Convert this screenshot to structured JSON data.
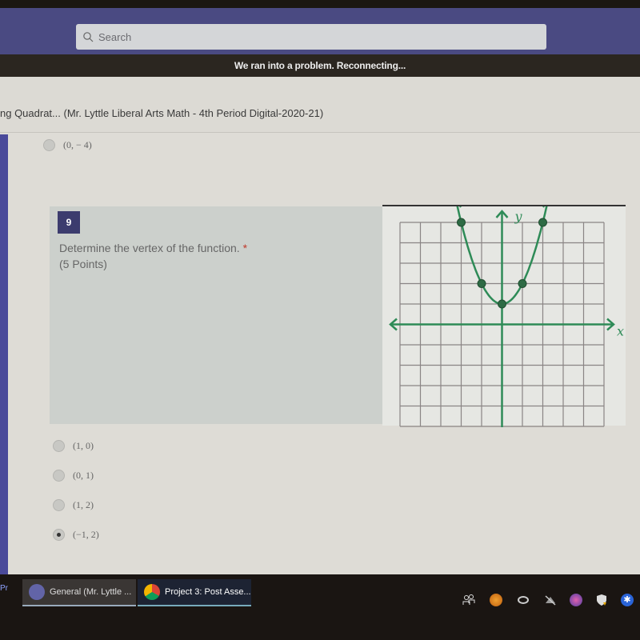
{
  "app": {
    "search_placeholder": "Search",
    "banner": "We ran into a problem. Reconnecting..."
  },
  "form": {
    "title": "ng Quadrat... (Mr. Lyttle Liberal Arts Math - 4th Period Digital-2020-21)",
    "previous_option": {
      "label": "(0,  − 4)",
      "selected": false
    }
  },
  "question": {
    "number": "9",
    "text": "Determine the vertex of the function.",
    "required_mark": "*",
    "points": "(5 Points)",
    "graph": {
      "x_label": "x",
      "y_label": "y",
      "x_range": [
        -5,
        5
      ],
      "y_range": [
        -5,
        5
      ],
      "curve": "parabola",
      "points": [
        [
          -2,
          5
        ],
        [
          -1,
          2
        ],
        [
          0,
          1
        ],
        [
          1,
          2
        ],
        [
          2,
          5
        ]
      ],
      "color": "#2e8b57"
    },
    "options": [
      {
        "label": "(1, 0)",
        "selected": false
      },
      {
        "label": "(0, 1)",
        "selected": false
      },
      {
        "label": "(1, 2)",
        "selected": false
      },
      {
        "label": "(−1, 2)",
        "selected": true
      }
    ]
  },
  "taskbar": {
    "left_fragment": "Pr",
    "items": [
      {
        "label": "General (Mr. Lyttle ...",
        "icon": "teams-icon"
      },
      {
        "label": "Project 3: Post Asse...",
        "icon": "chrome-icon"
      }
    ],
    "tray_icons": [
      "people-icon",
      "orange-circle-icon",
      "creative-cloud-icon",
      "network-icon",
      "teams-tray-icon",
      "security-shield-icon",
      "bluetooth-icon"
    ]
  }
}
